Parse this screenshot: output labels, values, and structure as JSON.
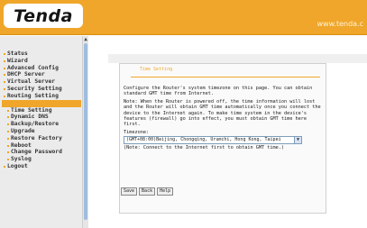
{
  "header": {
    "logo_text": "Tenda",
    "site_url": "www.tenda.c"
  },
  "sidebar": {
    "items": [
      {
        "label": "Status"
      },
      {
        "label": "Wizard"
      },
      {
        "label": "Advanced Config"
      },
      {
        "label": "DHCP Server"
      },
      {
        "label": "Virtual Server"
      },
      {
        "label": "Security Setting"
      },
      {
        "label": "Routing Setting"
      },
      {
        "label": "System Tools"
      },
      {
        "label": "Time Setting"
      },
      {
        "label": "Dynamic DNS"
      },
      {
        "label": "Backup/Restore"
      },
      {
        "label": "Upgrade"
      },
      {
        "label": "Restore Factory"
      },
      {
        "label": "Reboot"
      },
      {
        "label": "Change Password"
      },
      {
        "label": "Syslog"
      },
      {
        "label": "Logout"
      }
    ]
  },
  "panel": {
    "title": "Time Setting",
    "intro": "Configure the Router's system timezone on this page. You can obtain standard GMT time from Internet.",
    "note": "Note: When the Router is powered off, the time information will lost and the Router will obtain GMT time automatically once you connect the device to the Internet again. To make time system in the device's features (firewall) go into effect, you must obtain GMT time here first.",
    "timezone_label": "Timezone:",
    "timezone_value": "(GMT+08:00)Beijing, Chongqing, Urumchi, Hong Kong, Taipei",
    "connect_note": "(Note: Connect to the Internet first to obtain GMT time.)"
  },
  "buttons": {
    "save": "Save",
    "back": "Back",
    "help": "Help"
  },
  "colors": {
    "accent": "#f0a62a"
  }
}
